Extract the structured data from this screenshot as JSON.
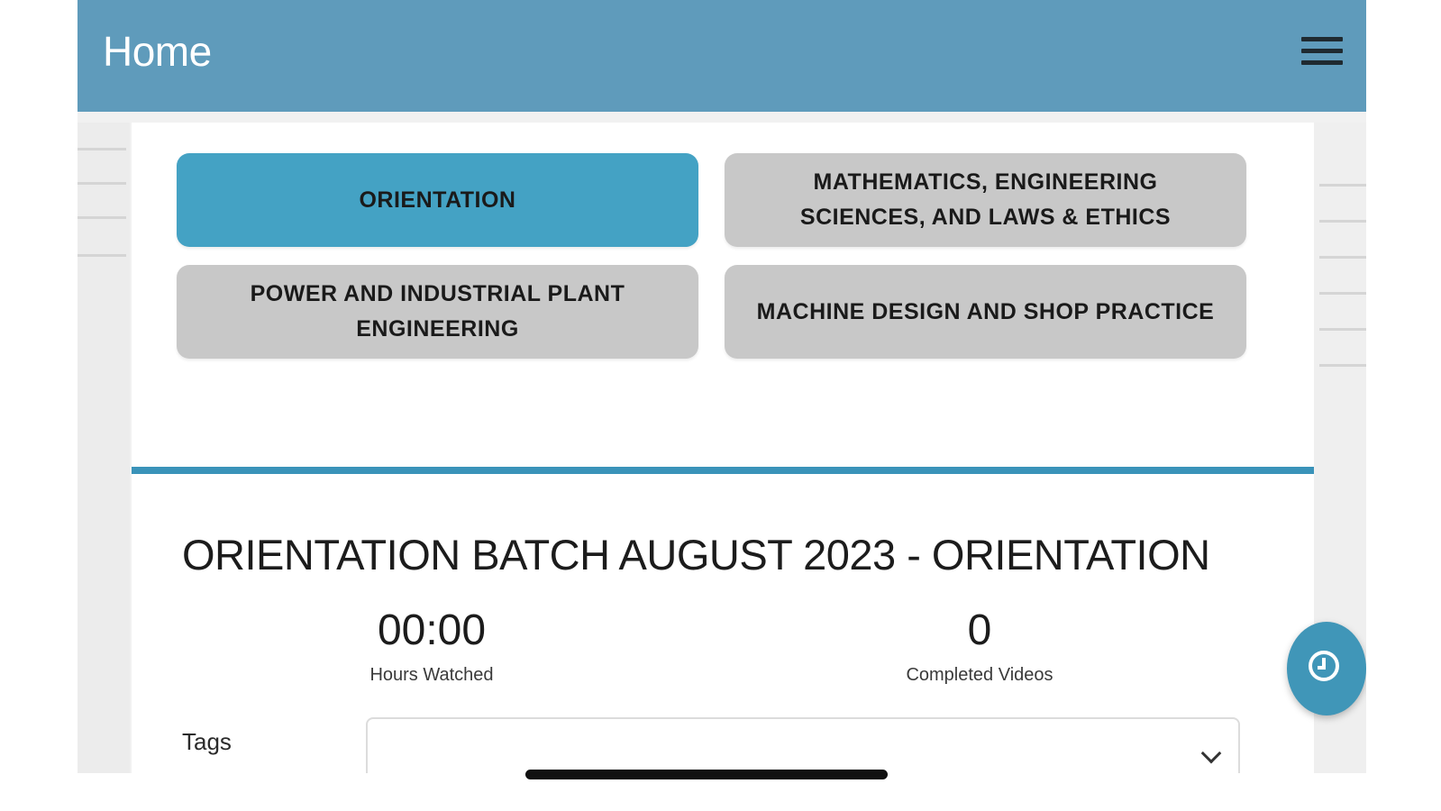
{
  "header": {
    "title": "Home",
    "menu_icon": "hamburger-menu-icon"
  },
  "categories": [
    {
      "label": "ORIENTATION",
      "active": true
    },
    {
      "label": "MATHEMATICS, ENGINEERING SCIENCES, AND LAWS & ETHICS",
      "active": false
    },
    {
      "label": "POWER AND INDUSTRIAL PLANT ENGINEERING",
      "active": false
    },
    {
      "label": "MACHINE DESIGN AND SHOP PRACTICE",
      "active": false
    }
  ],
  "batch": {
    "title": "ORIENTATION BATCH AUGUST 2023 - ORIENTATION"
  },
  "stats": {
    "hours_watched_value": "00:00",
    "hours_watched_label": "Hours Watched",
    "completed_videos_value": "0",
    "completed_videos_label": "Completed Videos"
  },
  "tags": {
    "label": "Tags",
    "value": ""
  },
  "fab": {
    "icon": "clock-icon"
  },
  "colors": {
    "header": "#5f9bbb",
    "accent": "#44a2c4",
    "inactive_button": "#c8c8c8",
    "divider": "#3a93b9",
    "fab": "#4096b8"
  }
}
